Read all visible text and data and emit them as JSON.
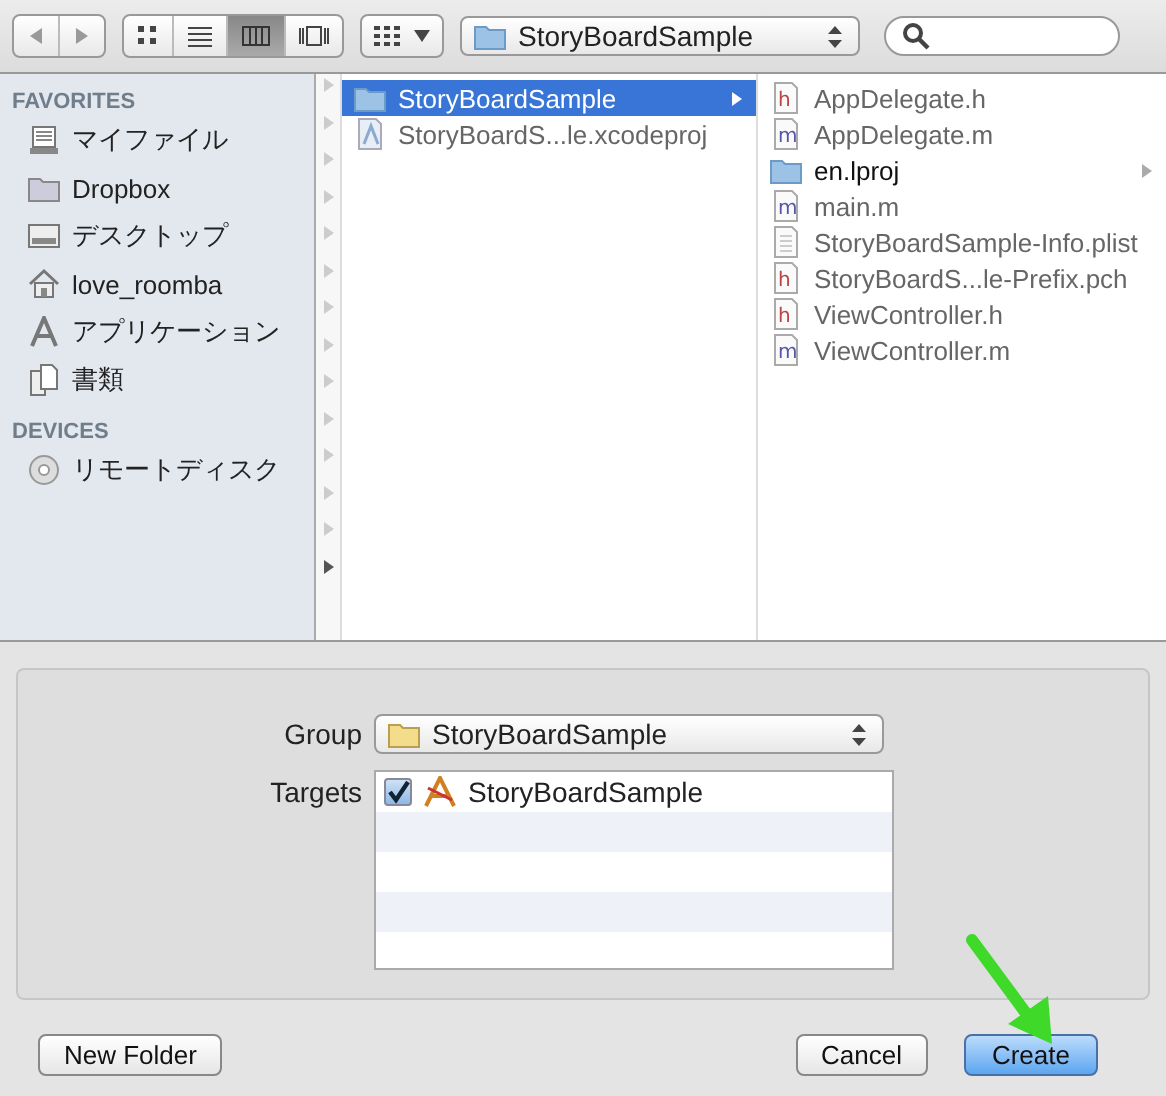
{
  "toolbar": {
    "view_modes": [
      {
        "kind": "icons",
        "selected": false
      },
      {
        "kind": "list",
        "selected": false
      },
      {
        "kind": "columns",
        "selected": true
      },
      {
        "kind": "coverflow",
        "selected": false
      }
    ],
    "location": "StoryBoardSample"
  },
  "sidebar": {
    "sections": [
      {
        "heading": "FAVORITES",
        "items": [
          {
            "kind": "drive",
            "label": "マイファイル"
          },
          {
            "kind": "folder",
            "label": "Dropbox"
          },
          {
            "kind": "desktop",
            "label": "デスクトップ"
          },
          {
            "kind": "home",
            "label": "love_roomba"
          },
          {
            "kind": "apps",
            "label": "アプリケーション"
          },
          {
            "kind": "docs",
            "label": "書類"
          }
        ]
      },
      {
        "heading": "DEVICES",
        "items": [
          {
            "kind": "disc",
            "label": "リモートディスク"
          }
        ]
      }
    ]
  },
  "columns": [
    [
      {
        "kind": "folder",
        "label": "StoryBoardSample",
        "selected": true,
        "has_children": true
      },
      {
        "kind": "project",
        "label": "StoryBoardS...le.xcodeproj",
        "selected": false,
        "has_children": false
      }
    ],
    [
      {
        "kind": "h",
        "label": "AppDelegate.h",
        "selected": false,
        "has_children": false
      },
      {
        "kind": "m",
        "label": "AppDelegate.m",
        "selected": false,
        "has_children": false
      },
      {
        "kind": "folder",
        "label": "en.lproj",
        "selected": false,
        "has_children": true
      },
      {
        "kind": "m",
        "label": "main.m",
        "selected": false,
        "has_children": false
      },
      {
        "kind": "plist",
        "label": "StoryBoardSample-Info.plist",
        "selected": false,
        "has_children": false
      },
      {
        "kind": "h",
        "label": "StoryBoardS...le-Prefix.pch",
        "selected": false,
        "has_children": false
      },
      {
        "kind": "h",
        "label": "ViewController.h",
        "selected": false,
        "has_children": false
      },
      {
        "kind": "m",
        "label": "ViewController.m",
        "selected": false,
        "has_children": false
      }
    ]
  ],
  "options": {
    "group_label": "Group",
    "group_value": "StoryBoardSample",
    "targets_label": "Targets",
    "targets": [
      {
        "label": "StoryBoardSample",
        "checked": true
      }
    ]
  },
  "buttons": [
    {
      "label": "New Folder",
      "default": false
    },
    {
      "label": "Cancel",
      "default": false
    },
    {
      "label": "Create",
      "default": true
    }
  ]
}
